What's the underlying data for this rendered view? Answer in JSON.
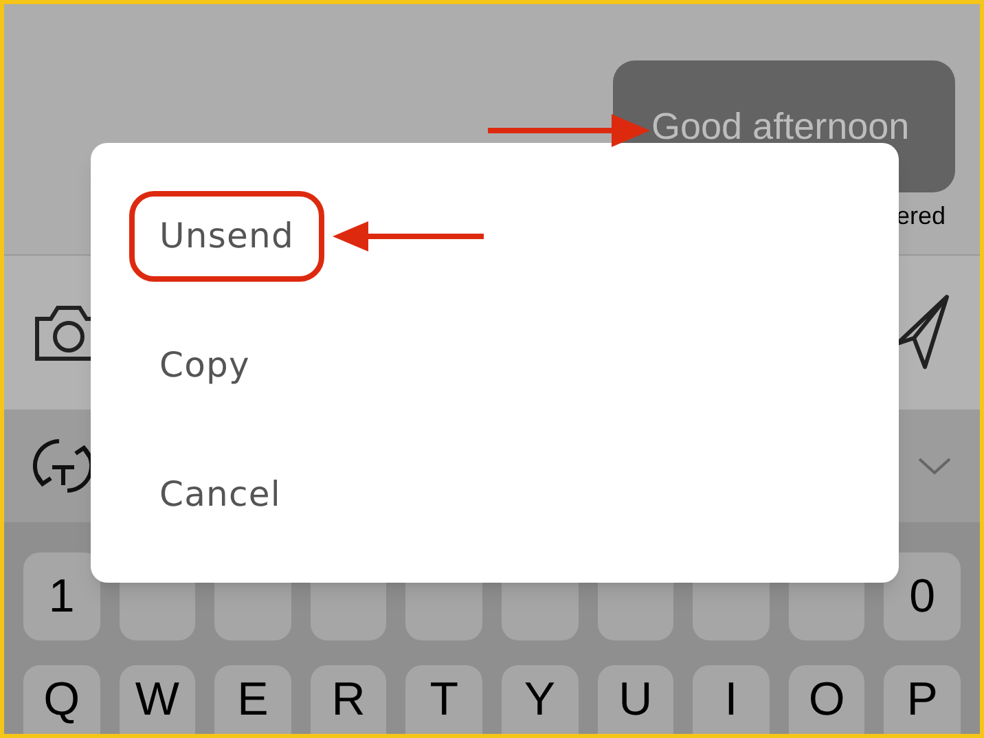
{
  "conversation": {
    "message": "Good afternoon",
    "status": "ered"
  },
  "dialog": {
    "options": [
      {
        "label": "Unsend",
        "highlighted": true
      },
      {
        "label": "Copy",
        "highlighted": false
      },
      {
        "label": "Cancel",
        "highlighted": false
      }
    ]
  },
  "keyboard": {
    "rows": [
      [
        {
          "kind": "key",
          "label": "1"
        },
        {
          "kind": "covered"
        },
        {
          "kind": "covered"
        },
        {
          "kind": "covered"
        },
        {
          "kind": "covered"
        },
        {
          "kind": "covered"
        },
        {
          "kind": "covered"
        },
        {
          "kind": "covered"
        },
        {
          "kind": "covered"
        },
        {
          "kind": "key",
          "label": "0"
        }
      ],
      [
        {
          "kind": "key",
          "label": "Q"
        },
        {
          "kind": "key",
          "label": "W"
        },
        {
          "kind": "key",
          "label": "E"
        },
        {
          "kind": "key",
          "label": "R"
        },
        {
          "kind": "key",
          "label": "T"
        },
        {
          "kind": "key",
          "label": "Y"
        },
        {
          "kind": "key",
          "label": "U"
        },
        {
          "kind": "key",
          "label": "I"
        },
        {
          "kind": "key",
          "label": "O"
        },
        {
          "kind": "key",
          "label": "P"
        }
      ]
    ]
  }
}
